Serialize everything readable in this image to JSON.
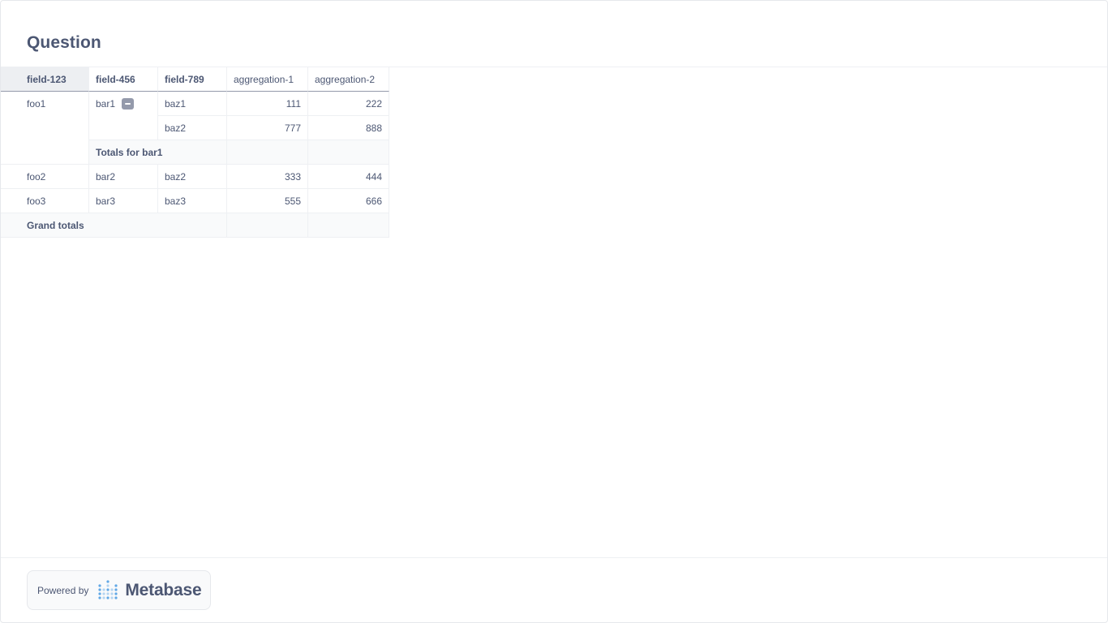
{
  "title": "Question",
  "pivot": {
    "row_headers": [
      "field-123",
      "field-456",
      "field-789"
    ],
    "value_headers": [
      "aggregation-1",
      "aggregation-2"
    ],
    "rows": [
      {
        "c1": "foo1",
        "c2": "bar1",
        "c3": "baz1",
        "v1": "111",
        "v2": "222"
      },
      {
        "c3": "baz2",
        "v1": "777",
        "v2": "888"
      },
      {
        "subtotal_label": "Totals for bar1",
        "v1": "",
        "v2": ""
      },
      {
        "c1": "foo2",
        "c2": "bar2",
        "c3": "baz2",
        "v1": "333",
        "v2": "444"
      },
      {
        "c1": "foo3",
        "c2": "bar3",
        "c3": "baz3",
        "v1": "555",
        "v2": "666"
      },
      {
        "grand_total_label": "Grand totals",
        "v1": "",
        "v2": ""
      }
    ],
    "collapse_icon": "minus-icon"
  },
  "footer": {
    "powered_by": "Powered by",
    "brand": "Metabase",
    "logo_icon": "metabase-logo-icon"
  },
  "colors": {
    "text": "#4c5773",
    "border": "#eef0f3",
    "header_highlight": "#edeff2",
    "total_bg": "#f9fafb",
    "logo_blue": "#509ee3"
  }
}
